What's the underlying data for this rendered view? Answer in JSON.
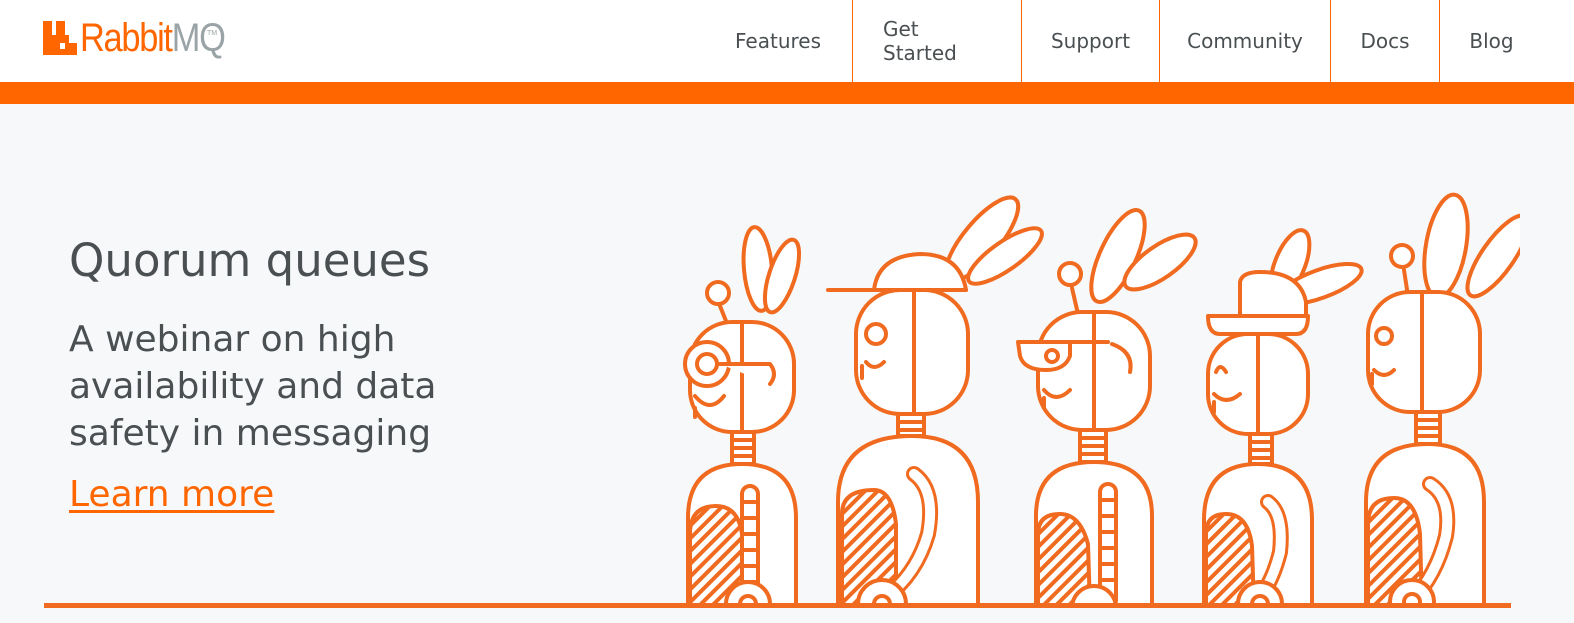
{
  "brand": {
    "name_part1": "Rabbit",
    "name_part2": "MQ",
    "trademark": "TM",
    "primary_color": "#ff6600",
    "secondary_color": "#9aa3a6"
  },
  "nav": {
    "items": [
      {
        "label": "Features"
      },
      {
        "label": "Get Started"
      },
      {
        "label": "Support"
      },
      {
        "label": "Community"
      },
      {
        "label": "Docs"
      },
      {
        "label": "Blog"
      }
    ]
  },
  "hero": {
    "title": "Quorum queues",
    "subtitle": "A webinar on high availability and data safety in messaging",
    "link_label": "Learn more",
    "illustration_icon": "robot-rabbits-illustration",
    "background_color": "#f7f8fa"
  }
}
